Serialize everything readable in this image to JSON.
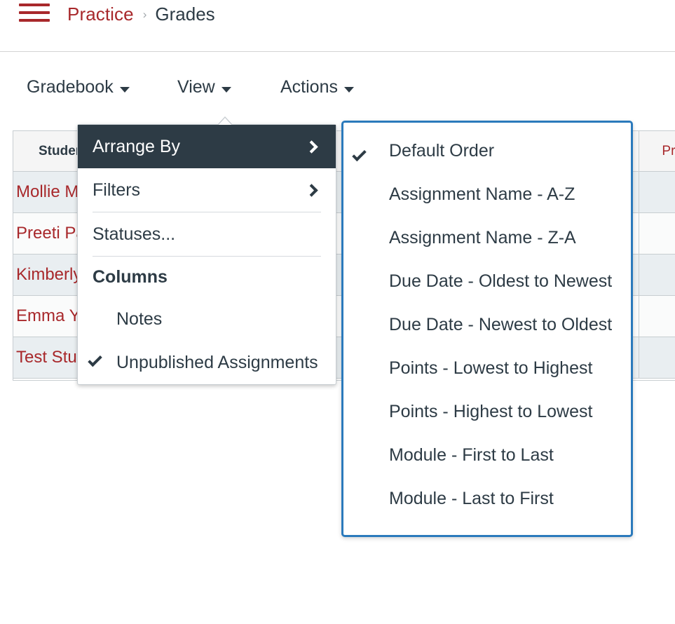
{
  "header": {
    "menu_icon": "hamburger-icon",
    "breadcrumb": {
      "course": "Practice",
      "separator": "›",
      "current": "Grades"
    }
  },
  "toolbar": {
    "buttons": [
      {
        "label": "Gradebook",
        "icon": "chevron-down-icon"
      },
      {
        "label": "View",
        "icon": "chevron-down-icon"
      },
      {
        "label": "Actions",
        "icon": "chevron-down-icon"
      }
    ]
  },
  "gradebook": {
    "columns": [
      "Student",
      "Pre"
    ],
    "students": [
      "Mollie M",
      "Preeti Pa",
      "Kimberly",
      "Emma Yo",
      "Test Stud"
    ]
  },
  "view_menu": {
    "items": [
      {
        "label": "Arrange By",
        "icon": "chevron-right-icon",
        "highlighted": true,
        "has_submenu": true
      },
      {
        "label": "Filters",
        "icon": "chevron-right-icon",
        "highlighted": false,
        "has_submenu": true
      },
      {
        "label": "Statuses...",
        "highlighted": false,
        "has_submenu": false
      }
    ],
    "columns_heading": "Columns",
    "column_options": [
      {
        "label": "Notes",
        "checked": false
      },
      {
        "label": "Unpublished Assignments",
        "checked": true
      }
    ]
  },
  "arrange_by_submenu": {
    "options": [
      {
        "label": "Default Order",
        "checked": true
      },
      {
        "label": "Assignment Name - A-Z",
        "checked": false
      },
      {
        "label": "Assignment Name - Z-A",
        "checked": false
      },
      {
        "label": "Due Date - Oldest to Newest",
        "checked": false
      },
      {
        "label": "Due Date - Newest to Oldest",
        "checked": false
      },
      {
        "label": "Points - Lowest to Highest",
        "checked": false
      },
      {
        "label": "Points - Highest to Lowest",
        "checked": false
      },
      {
        "label": "Module - First to Last",
        "checked": false
      },
      {
        "label": "Module - Last to First",
        "checked": false
      }
    ]
  },
  "colors": {
    "brand_red": "#A8282B",
    "text_dark": "#2D3B45",
    "highlight_bg": "#2D3B45",
    "submenu_border": "#2B7ABC",
    "row_odd": "#E9EEF1",
    "row_even": "#FAFBFB",
    "grid_border": "#C7CDD1"
  }
}
